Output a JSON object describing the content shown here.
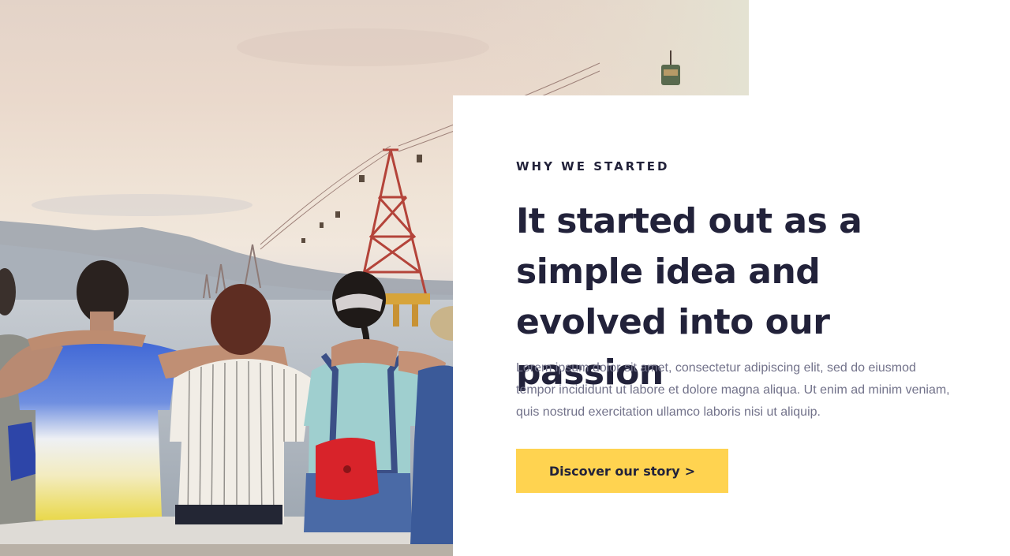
{
  "hero": {
    "image_description": "Group of friends sitting with arms around each other facing the sea and cable car towers",
    "icon": "hero-photo"
  },
  "section": {
    "eyebrow": "WHY WE STARTED",
    "headline": "It started out as a simple idea and evolved into our passion",
    "body": "Lorem ipsum dolor sit amet, consectetur adipiscing elit, sed do eiusmod tempor incididunt ut labore et dolore magna aliqua. Ut enim ad minim veniam, quis nostrud exercitation ullamco laboris nisi ut aliquip.",
    "cta_label": "Discover our story",
    "cta_suffix": ">"
  },
  "colors": {
    "heading": "#22223a",
    "body": "#72728a",
    "cta_background": "#ffd350",
    "background": "#ffffff"
  }
}
